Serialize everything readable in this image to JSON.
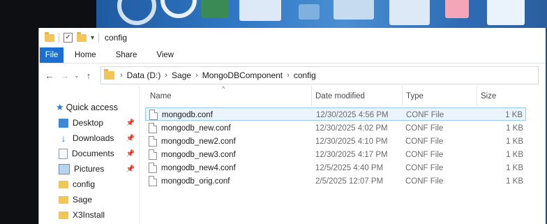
{
  "window": {
    "title": "config"
  },
  "ribbon": {
    "tabs": [
      "File",
      "Home",
      "Share",
      "View"
    ]
  },
  "address": {
    "path": [
      "Data (D:)",
      "Sage",
      "MongoDBComponent",
      "config"
    ]
  },
  "nav": {
    "quick_access": "Quick access",
    "items": [
      {
        "label": "Desktop",
        "icon": "desktop-icon",
        "pinned": true
      },
      {
        "label": "Downloads",
        "icon": "downloads-icon",
        "pinned": true
      },
      {
        "label": "Documents",
        "icon": "documents-icon",
        "pinned": true
      },
      {
        "label": "Pictures",
        "icon": "pictures-icon",
        "pinned": true
      },
      {
        "label": "config",
        "icon": "folder-icon",
        "pinned": false
      },
      {
        "label": "Sage",
        "icon": "folder-icon",
        "pinned": false
      },
      {
        "label": "X3Install",
        "icon": "folder-icon",
        "pinned": false
      }
    ]
  },
  "columns": {
    "name": "Name",
    "date": "Date modified",
    "type": "Type",
    "size": "Size"
  },
  "files": [
    {
      "name": "mongodb.conf",
      "date": "12/30/2025 4:56 PM",
      "type": "CONF File",
      "size": "1 KB"
    },
    {
      "name": "mongodb_new.conf",
      "date": "12/30/2025 4:02 PM",
      "type": "CONF File",
      "size": "1 KB"
    },
    {
      "name": "mongodb_new2.conf",
      "date": "12/30/2025 4:10 PM",
      "type": "CONF File",
      "size": "1 KB"
    },
    {
      "name": "mongodb_new3.conf",
      "date": "12/30/2025 4:17 PM",
      "type": "CONF File",
      "size": "1 KB"
    },
    {
      "name": "mongodb_new4.conf",
      "date": "12/5/2025 4:40 PM",
      "type": "CONF File",
      "size": "1 KB"
    },
    {
      "name": "mongodb_orig.conf",
      "date": "2/5/2025 12:07 PM",
      "type": "CONF File",
      "size": "1 KB"
    }
  ],
  "colors": {
    "file_tab": "#1a6fd1",
    "selection": "#eaf4fd",
    "folder": "#f1c659"
  }
}
